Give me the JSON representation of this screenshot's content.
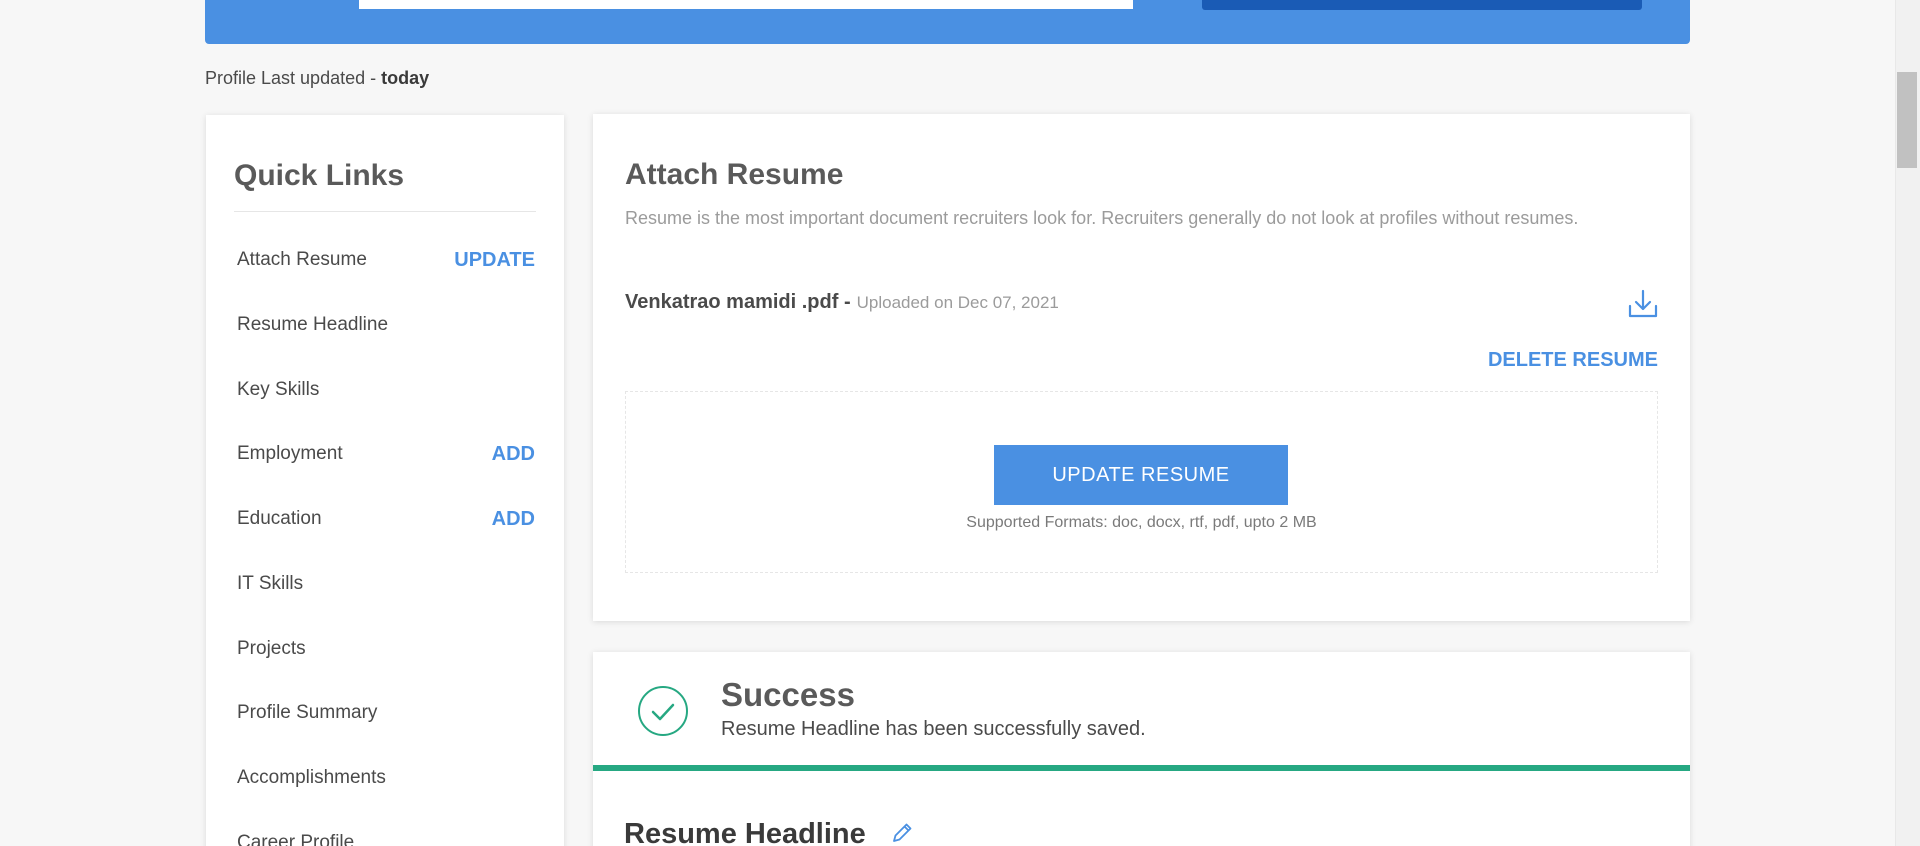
{
  "header": {
    "last_updated_label": "Profile Last updated - ",
    "last_updated_value": "today"
  },
  "quick_links": {
    "title": "Quick Links",
    "items": [
      {
        "label": "Attach Resume",
        "action": "UPDATE"
      },
      {
        "label": "Resume Headline",
        "action": ""
      },
      {
        "label": "Key Skills",
        "action": ""
      },
      {
        "label": "Employment",
        "action": "ADD"
      },
      {
        "label": "Education",
        "action": "ADD"
      },
      {
        "label": "IT Skills",
        "action": ""
      },
      {
        "label": "Projects",
        "action": ""
      },
      {
        "label": "Profile Summary",
        "action": ""
      },
      {
        "label": "Accomplishments",
        "action": ""
      },
      {
        "label": "Career Profile",
        "action": ""
      }
    ]
  },
  "attach_resume": {
    "title": "Attach Resume",
    "description": "Resume is the most important document recruiters look for. Recruiters generally do not look at profiles without resumes.",
    "file_name": "Venkatrao mamidi .pdf -",
    "uploaded_on": "Uploaded on Dec 07, 2021",
    "delete_label": "DELETE RESUME",
    "update_label": "UPDATE RESUME",
    "supported_formats": "Supported Formats: doc, docx, rtf, pdf, upto 2 MB",
    "download_icon": "download-icon"
  },
  "success": {
    "title": "Success",
    "message": "Resume Headline has been successfully saved.",
    "icon": "check-circle-icon",
    "accent_color": "#26a882"
  },
  "resume_headline": {
    "title": "Resume Headline",
    "edit_icon": "pencil-icon"
  },
  "colors": {
    "primary": "#4a90e2",
    "banner": "#4a90e2",
    "banner_button": "#1a5bb5",
    "success": "#26a882"
  }
}
